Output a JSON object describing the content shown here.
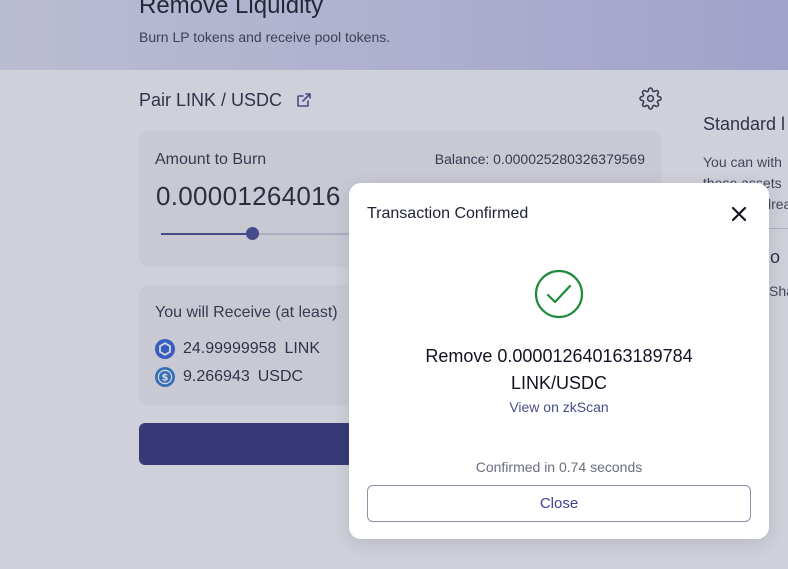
{
  "header": {
    "title": "Remove Liquidity",
    "subtitle": "Burn LP tokens and receive pool tokens."
  },
  "pair": {
    "title": "Pair LINK / USDC"
  },
  "burn": {
    "label": "Amount to Burn",
    "balance": "Balance: 0.000025280326379569",
    "amount": "0.00001264016",
    "slider_fraction": 0.19
  },
  "receive": {
    "label": "You will Receive (at least)",
    "tokens": [
      {
        "value": "24.99999958",
        "symbol": "LINK",
        "icon": "chainlink-icon"
      },
      {
        "value": "9.266943",
        "symbol": "USDC",
        "icon": "usdc-icon"
      }
    ]
  },
  "side": {
    "title": "Standard l",
    "line1": "You can with",
    "line2": "these assets",
    "line3": "lrea",
    "title2": "ctio",
    "line4": "Sha"
  },
  "modal": {
    "title": "Transaction Confirmed",
    "summary_line1": "Remove 0.000012640163189784",
    "summary_line2": "LINK/USDC",
    "link": "View on zkScan",
    "status": "Confirmed in 0.74 seconds",
    "close_label": "Close"
  },
  "colors": {
    "accent": "#3f4290",
    "success": "#1e8a3c",
    "link_token": "#2a5ada",
    "usdc_token": "#2775ca"
  }
}
